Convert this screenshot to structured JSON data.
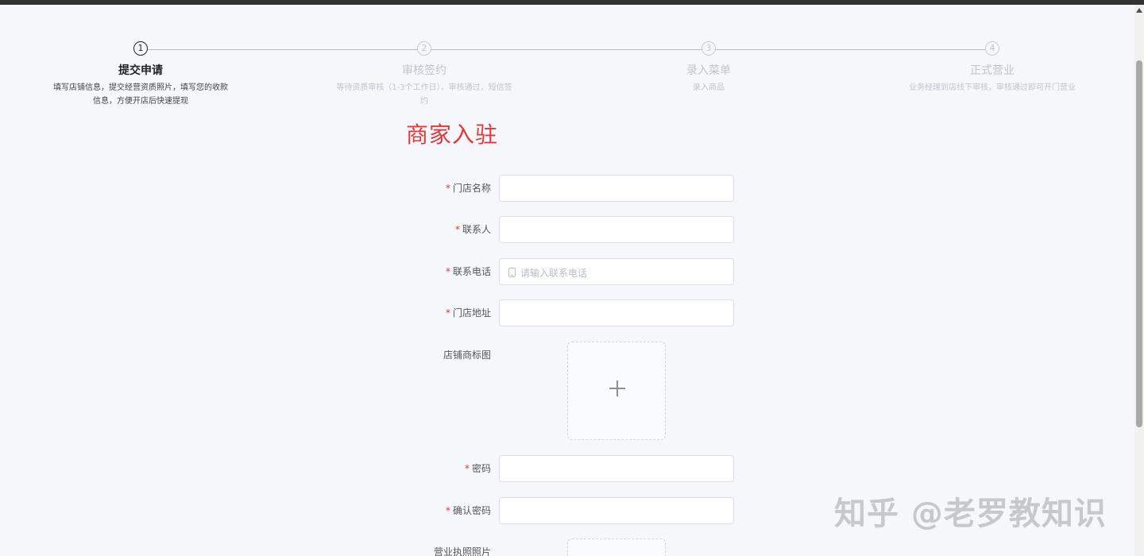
{
  "steps": [
    {
      "number": "1",
      "title": "提交申请",
      "desc": "填写店铺信息，提交经营资质照片，填写您的收款信息，方便开店后快速提现"
    },
    {
      "number": "2",
      "title": "审核签约",
      "desc": "等待资质审核（1-3个工作日），审核通过，短信签约"
    },
    {
      "number": "3",
      "title": "录入菜单",
      "desc": "录入商品"
    },
    {
      "number": "4",
      "title": "正式营业",
      "desc": "业务经理到店线下审核，审核通过即可开门营业"
    }
  ],
  "page_title": "商家入驻",
  "form": {
    "required_mark": "*",
    "store_name": {
      "label": "门店名称",
      "value": ""
    },
    "contact": {
      "label": "联系人",
      "value": ""
    },
    "phone": {
      "label": "联系电话",
      "placeholder": "请输入联系电话"
    },
    "address": {
      "label": "门店地址",
      "value": ""
    },
    "logo": {
      "label": "店铺商标图"
    },
    "password": {
      "label": "密码",
      "value": ""
    },
    "confirm_password": {
      "label": "确认密码",
      "value": ""
    },
    "license": {
      "label": "营业执照照片"
    }
  },
  "watermark": "知乎 @老罗教知识",
  "colors": {
    "accent": "#e0383a",
    "active_step": "#222222",
    "inactive": "#c0c4cc"
  }
}
